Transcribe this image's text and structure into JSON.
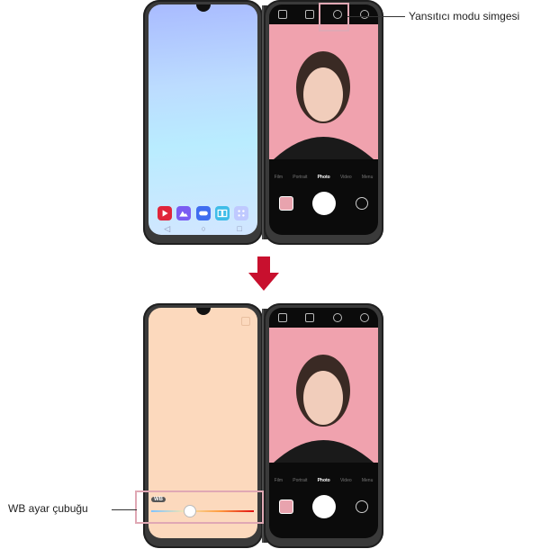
{
  "callouts": {
    "mirror_mode_icon": "Yansıtıcı modu simgesi",
    "wb_bar": "WB ayar çubuğu"
  },
  "camera": {
    "modes": [
      "Film",
      "Portrait",
      "Photo",
      "Video",
      "Menu"
    ],
    "active_mode": "Photo"
  },
  "wb": {
    "label": "WB",
    "level": 0.35
  },
  "colors": {
    "arrow": "#c8102e",
    "callout_box": "#e0a8b4",
    "mirror_screen": "#fcd9bd"
  },
  "dock_icons": [
    "youtube-icon",
    "gallery-icon",
    "game-icon",
    "dual-screen-icon",
    "apps-icon"
  ]
}
